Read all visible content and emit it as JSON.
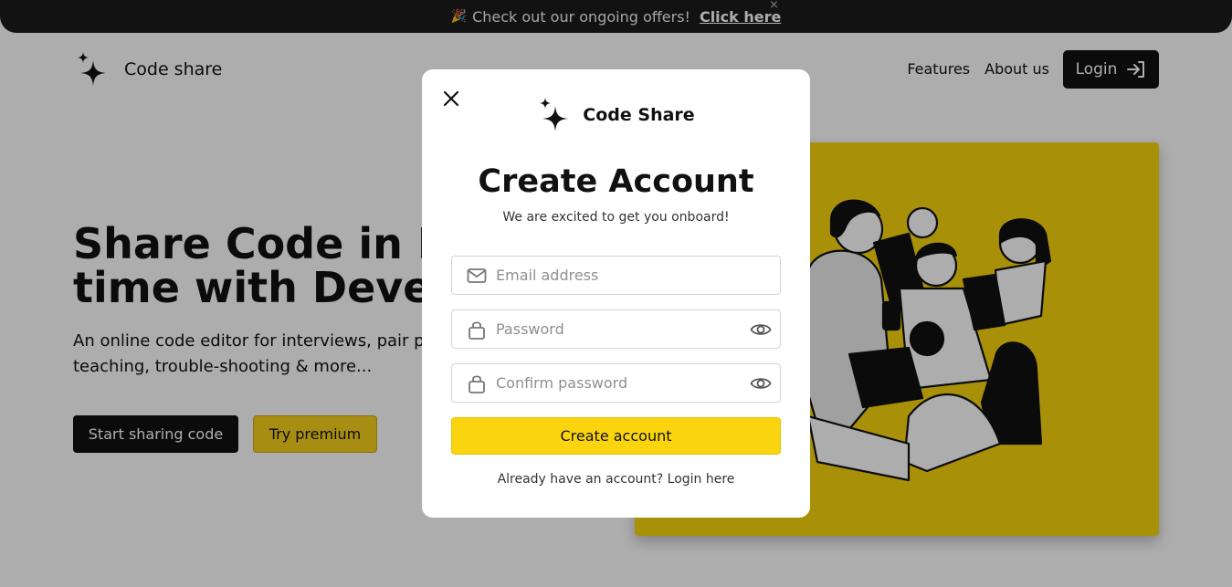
{
  "announcement": {
    "emoji": "🎉",
    "text": "Check out our ongoing offers!",
    "link": "Click here",
    "close": "×"
  },
  "brand": {
    "name": "Code share"
  },
  "nav": {
    "links": [
      "Features",
      "About us"
    ],
    "login": "Login"
  },
  "hero": {
    "title_line1": "Share Code in R",
    "title_line2": "time with Develo",
    "subtitle_line1": "An online code editor for interviews, pair pr",
    "subtitle_line2": "teaching, trouble-shooting & more...",
    "start_button": "Start sharing code",
    "premium_button": "Try premium"
  },
  "modal": {
    "brand": "Code Share",
    "title": "Create Account",
    "tagline": "We are excited to get you onboard!",
    "email_placeholder": "Email address",
    "password_placeholder": "Password",
    "confirm_placeholder": "Confirm password",
    "submit": "Create account",
    "login_prompt": "Already have an account? Login here"
  },
  "colors": {
    "accent": "#fad40e",
    "dark": "#111111",
    "announcement_bg": "#1b1b1b"
  }
}
